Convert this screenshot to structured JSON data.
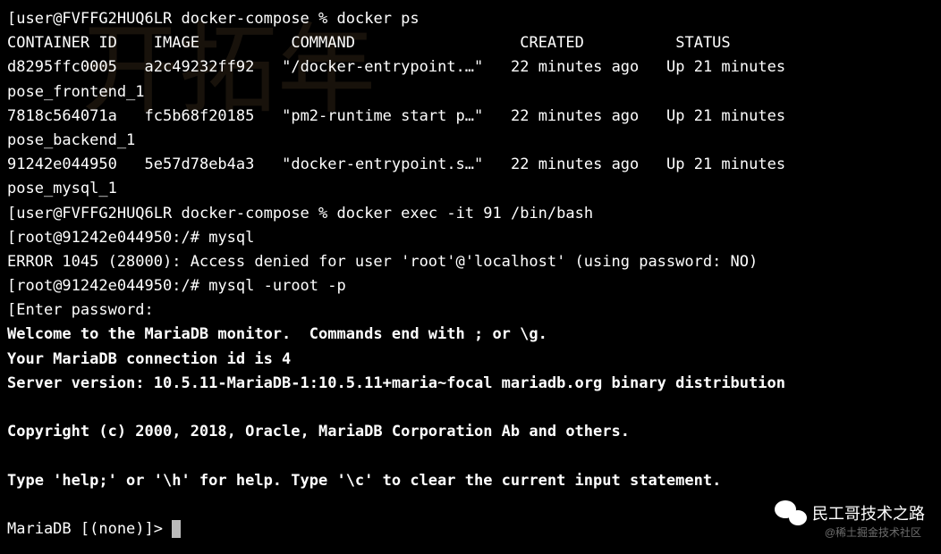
{
  "prompt1": {
    "user": "user@FVFFG2HUQ6LR",
    "dir": "docker-compose",
    "cmd": "docker ps"
  },
  "table": {
    "headers": {
      "container_id": "CONTAINER ID",
      "image": "IMAGE",
      "command": "COMMAND",
      "created": "CREATED",
      "status": "STATUS"
    },
    "rows": [
      {
        "container_id": "d8295ffc0005",
        "image": "a2c49232ff92",
        "command": "\"/docker-entrypoint.…\"",
        "created": "22 minutes ago",
        "status": "Up 21 minutes",
        "name_line": "pose_frontend_1"
      },
      {
        "container_id": "7818c564071a",
        "image": "fc5b68f20185",
        "command": "\"pm2-runtime start p…\"",
        "created": "22 minutes ago",
        "status": "Up 21 minutes",
        "name_line": "pose_backend_1"
      },
      {
        "container_id": "91242e044950",
        "image": "5e57d78eb4a3",
        "command": "\"docker-entrypoint.s…\"",
        "created": "22 minutes ago",
        "status": "Up 21 minutes",
        "name_line": "pose_mysql_1"
      }
    ]
  },
  "prompt2": {
    "user": "user@FVFFG2HUQ6LR",
    "dir": "docker-compose",
    "cmd": "docker exec -it 91 /bin/bash"
  },
  "prompt3": {
    "user": "root@91242e044950:/#",
    "cmd": "mysql"
  },
  "error_line": "ERROR 1045 (28000): Access denied for user 'root'@'localhost' (using password: NO)",
  "prompt4": {
    "user": "root@91242e044950:/#",
    "cmd": "mysql -uroot -p"
  },
  "enter_pw": "Enter password:",
  "mariadb": {
    "welcome": "Welcome to the MariaDB monitor.  Commands end with ; or \\g.",
    "conn": "Your MariaDB connection id is 4",
    "version": "Server version: 10.5.11-MariaDB-1:10.5.11+maria~focal mariadb.org binary distribution",
    "copyright": "Copyright (c) 2000, 2018, Oracle, MariaDB Corporation Ab and others.",
    "help": "Type 'help;' or '\\h' for help. Type '\\c' to clear the current input statement.",
    "prompt": "MariaDB [(none)]>"
  },
  "watermark": {
    "bg": "开拓年",
    "badge": "民工哥技术之路",
    "sub": "@稀土掘金技术社区"
  }
}
